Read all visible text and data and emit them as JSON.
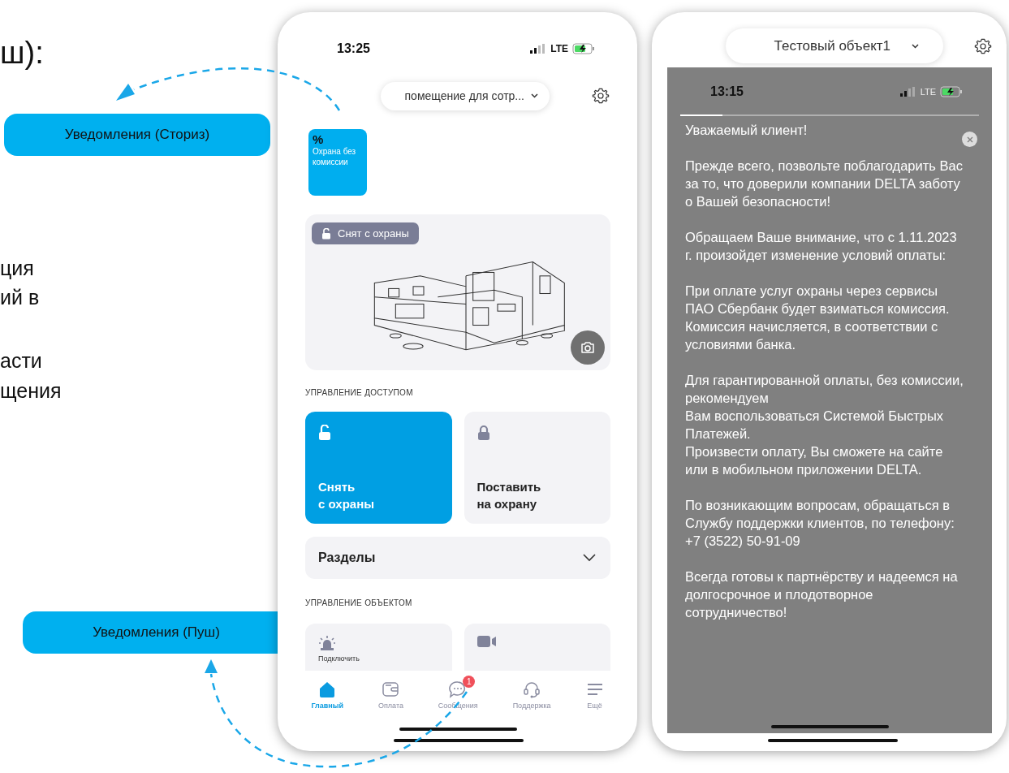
{
  "slide_text": {
    "heading_fragment": "ш):",
    "body_fragments": [
      "ция",
      "ий в",
      "асти",
      "щения"
    ]
  },
  "callouts": [
    {
      "label": "Уведомления (Сториз)"
    },
    {
      "label": "Уведомления (Пуш)"
    }
  ],
  "phone_home": {
    "status": {
      "time": "13:25",
      "network": "LTE"
    },
    "object_selector": "помещение для сотр...",
    "promo": {
      "symbol": "%",
      "label": "Охрана без комиссии"
    },
    "status_badge": "Снят с охраны",
    "access_title": "УПРАВЛЕНИЕ ДОСТУПОМ",
    "access_tiles": [
      {
        "label": "Снять\nс охраны",
        "active": true
      },
      {
        "label": "Поставить\nна охрану",
        "active": false
      }
    ],
    "sections_row": "Разделы",
    "object_title": "УПРАВЛЕНИЕ ОБЪЕКТОМ",
    "object_tiles": [
      {
        "kind": "siren",
        "label": "Подключить"
      },
      {
        "kind": "camera"
      }
    ],
    "tabs": [
      {
        "label": "Главный",
        "selected": true
      },
      {
        "label": "Оплата",
        "selected": false
      },
      {
        "label": "Сообщения",
        "selected": false,
        "badge": "1"
      },
      {
        "label": "Поддержка",
        "selected": false
      },
      {
        "label": "Ещё",
        "selected": false
      }
    ]
  },
  "phone_story": {
    "object_selector": "Тестовый объект1",
    "story": {
      "status": {
        "time": "13:15",
        "network": "LTE"
      },
      "level": 0.14,
      "paragraphs": [
        "Уважаемый клиент!",
        "Прежде всего, позвольте поблагодарить Вас за то, что доверили компании DELTA заботу о Вашей безопасности!",
        "Обращаем Ваше внимание, что с 1.11.2023 г. произойдет изменение условий оплаты:",
        "При оплате услуг охраны через сервисы ПАО Сбербанк будет взиматься комиссия.\nКомиссия начисляется, в соответствии с условиями банка.",
        "Для гарантированной оплаты, без комиссии, рекомендуем\nВам воспользоваться Системой Быстрых Платежей.\nПроизвести оплату, Вы сможете на сайте или в мобильном приложении DELTA.",
        "По возникающим вопросам, обращаться в Службу поддержки клиентов, по телефону:  +7 (3522) 50-91-09",
        "Всегда готовы к партнёрству и надеемся на долгосрочное и плодотворное сотрудничество!"
      ]
    }
  }
}
